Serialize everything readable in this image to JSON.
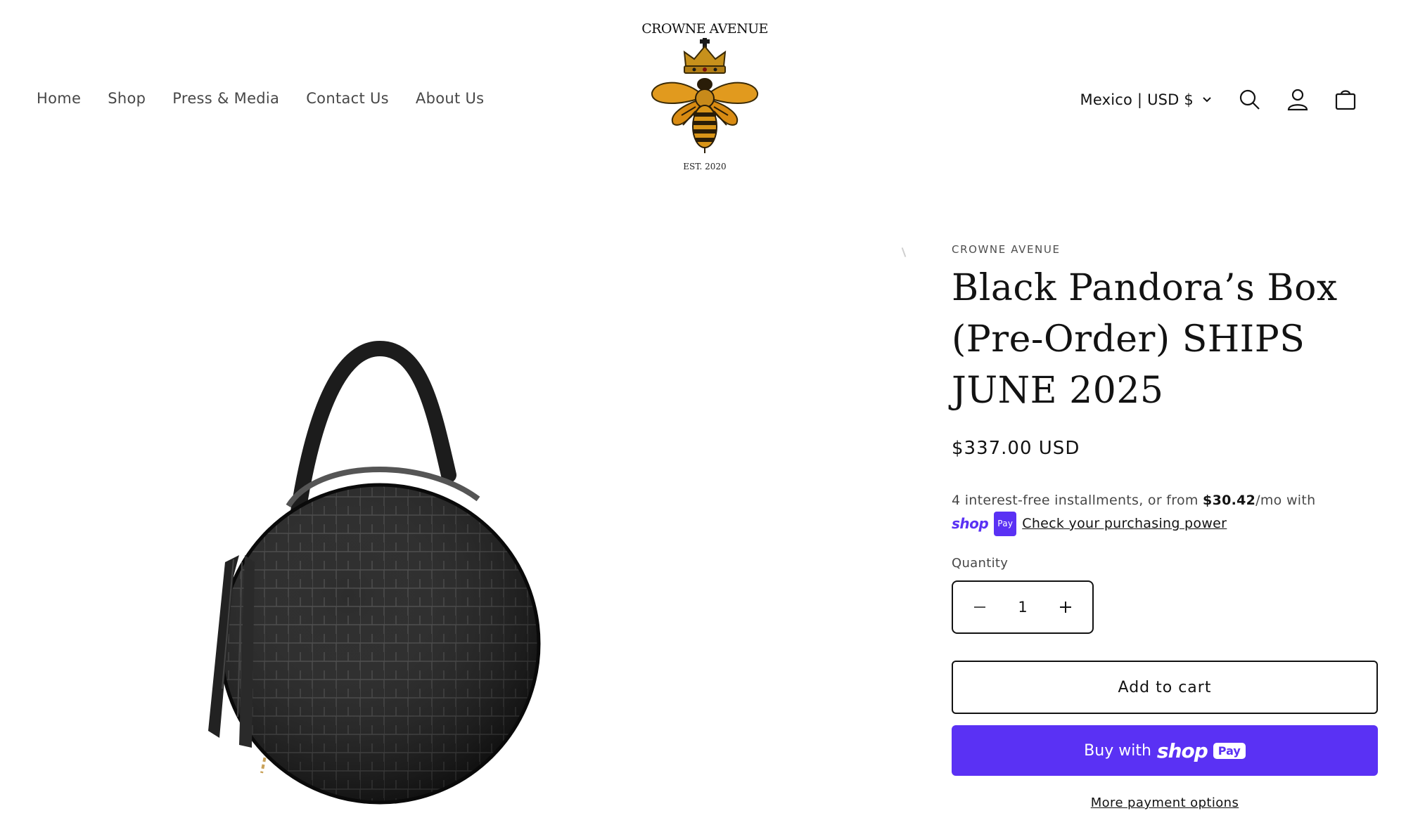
{
  "header": {
    "nav": [
      "Home",
      "Shop",
      "Press & Media",
      "Contact Us",
      "About Us"
    ],
    "logo": {
      "title": "CROWNE AVENUE",
      "est": "EST. 2020"
    },
    "localization": "Mexico | USD $",
    "icons": [
      "search-icon",
      "account-icon",
      "cart-icon"
    ]
  },
  "product": {
    "vendor": "CROWNE AVENUE",
    "title": "Black Pandora’s Box (Pre-Order) SHIPS JUNE 2025",
    "price": "$337.00 USD",
    "installments": {
      "prefix": "4 interest-free installments, or from ",
      "amount": "$30.42",
      "suffix": "/mo with",
      "shop_text": "shop",
      "pay_badge": "Pay",
      "check_link": "Check your purchasing power"
    },
    "quantity_label": "Quantity",
    "quantity_value": "1",
    "add_to_cart": "Add to cart",
    "buy_now_prefix": "Buy with",
    "buy_now_shop": "shop",
    "buy_now_pay": "Pay",
    "more_options": "More payment options"
  },
  "colors": {
    "shop_pay": "#5a31f4",
    "text": "#121212",
    "bee_gold": "#d9901c",
    "crown_gold": "#c7911c"
  }
}
